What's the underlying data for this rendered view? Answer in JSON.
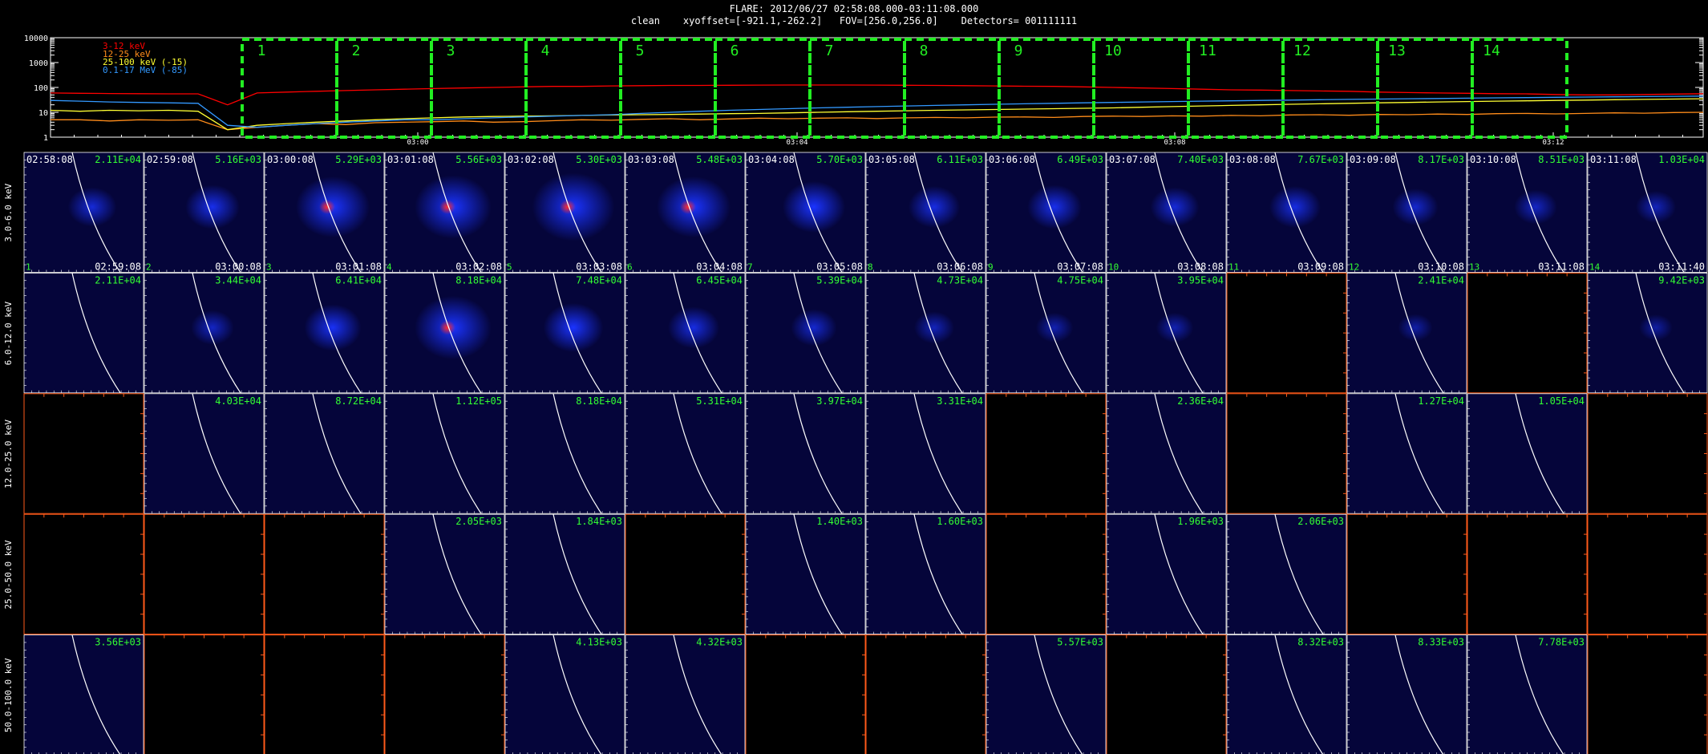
{
  "header": {
    "line1": "FLARE: 2012/06/27 02:58:08.000-03:11:08.000",
    "line2": "clean    xyoffset=[-921.1,-262.2]   FOV=[256.0,256.0]    Detectors= 001111111"
  },
  "chart_data": [
    {
      "type": "line",
      "name": "lightcurve",
      "yscale": "log",
      "ylim": [
        1,
        10000
      ],
      "y_ticks": [
        "10000",
        "1000",
        "100",
        "10",
        "1"
      ],
      "x_ticks": [
        "03:00",
        "03:04",
        "03:08",
        "03:12"
      ],
      "legend_position": "top-left",
      "series": [
        {
          "name": "3-12 keV",
          "color": "#ff0000",
          "values": [
            60,
            58,
            57,
            56,
            55,
            55,
            20,
            60,
            65,
            70,
            75,
            80,
            85,
            90,
            95,
            100,
            105,
            110,
            110,
            115,
            118,
            120,
            120,
            122,
            124,
            125,
            125,
            125,
            124,
            122,
            120,
            118,
            115,
            112,
            110,
            105,
            100,
            95,
            90,
            85,
            80,
            78,
            75,
            72,
            70,
            65,
            62,
            60,
            58,
            56,
            55,
            52,
            50,
            50,
            52,
            54,
            56
          ]
        },
        {
          "name": "12-25 keV",
          "color": "#ff8c1a",
          "values": [
            5,
            5,
            4.5,
            5,
            4.8,
            5,
            2,
            2.5,
            3,
            3.5,
            3.2,
            3.8,
            4,
            4.2,
            4.5,
            4,
            4.2,
            4.6,
            5,
            4.8,
            5.2,
            5.5,
            5,
            5.4,
            5.8,
            5.5,
            5.8,
            6,
            5.6,
            6,
            6.2,
            6,
            6.4,
            6.5,
            6.2,
            6.8,
            7,
            6.8,
            7.2,
            7,
            7.5,
            7.2,
            7.8,
            8,
            7.6,
            8.2,
            8,
            8.5,
            8.2,
            8.8,
            9,
            8.6,
            9,
            9.5,
            9.2,
            9.8,
            10
          ]
        },
        {
          "name": "25-100 keV (-15)",
          "color": "#ffff33",
          "values": [
            12,
            11,
            12,
            11.5,
            12,
            11,
            2,
            3,
            3.5,
            4,
            4.5,
            5,
            5.5,
            6,
            6.5,
            6.8,
            7,
            7.2,
            7.5,
            7.8,
            8,
            8.2,
            8.5,
            8.8,
            9,
            9.5,
            10,
            10.5,
            11,
            11.5,
            12,
            12.5,
            13,
            13.5,
            14,
            14.5,
            15,
            16,
            17,
            18,
            19,
            20,
            21,
            22,
            23,
            24,
            25,
            26,
            27,
            28,
            29,
            30,
            31,
            32,
            33,
            34,
            35
          ]
        },
        {
          "name": "0.1-17 MeV (-85)",
          "color": "#3399ff",
          "values": [
            30,
            28,
            26,
            25,
            24,
            23,
            3,
            2.5,
            3,
            3.5,
            4,
            4.5,
            5,
            5,
            5.5,
            6,
            6.5,
            7,
            7.5,
            8,
            9,
            10,
            11,
            12,
            13,
            14,
            15,
            16,
            17,
            18,
            19,
            20,
            21,
            22,
            23,
            24,
            25,
            26,
            27,
            28,
            29,
            30,
            31,
            32,
            33,
            34,
            35,
            36,
            37,
            38,
            39,
            40,
            41,
            42,
            43,
            44,
            45
          ]
        }
      ],
      "intervals": [
        "1",
        "2",
        "3",
        "4",
        "5",
        "6",
        "7",
        "8",
        "9",
        "10",
        "11",
        "12",
        "13",
        "14"
      ]
    },
    {
      "type": "heatmap",
      "name": "image-grid",
      "rows": [
        "3.0-6.0 keV",
        "6.0-12.0 keV",
        "12.0-25.0 keV",
        "25.0-50.0 keV",
        "50.0-100.0 keV"
      ],
      "start_times": [
        "02:58:08",
        "02:59:08",
        "03:00:08",
        "03:01:08",
        "03:02:08",
        "03:03:08",
        "03:04:08",
        "03:05:08",
        "03:06:08",
        "03:07:08",
        "03:08:08",
        "03:09:08",
        "03:10:08",
        "03:11:08"
      ],
      "end_times": [
        "02:59:08",
        "03:00:08",
        "03:01:08",
        "03:02:08",
        "03:03:08",
        "03:04:08",
        "03:05:08",
        "03:06:08",
        "03:07:08",
        "03:08:08",
        "03:09:08",
        "03:10:08",
        "03:11:08",
        "03:11:40"
      ],
      "interval_numbers": [
        "1",
        "2",
        "3",
        "4",
        "5",
        "6",
        "7",
        "8",
        "9",
        "10",
        "11",
        "12",
        "13",
        "14"
      ],
      "maxima": [
        [
          "2.11E+04",
          "5.16E+03",
          "5.29E+03",
          "5.56E+03",
          "5.30E+03",
          "5.48E+03",
          "5.70E+03",
          "6.11E+03",
          "6.49E+03",
          "7.40E+03",
          "7.67E+03",
          "8.17E+03",
          "8.51E+03",
          "1.03E+04"
        ],
        [
          "2.11E+04",
          "3.44E+04",
          "6.41E+04",
          "8.18E+04",
          "7.48E+04",
          "6.45E+04",
          "5.39E+04",
          "4.73E+04",
          "4.75E+04",
          "3.95E+04",
          null,
          "2.41E+04",
          null,
          "9.42E+03"
        ],
        [
          null,
          "4.03E+04",
          "8.72E+04",
          "1.12E+05",
          "8.18E+04",
          "5.31E+04",
          "3.97E+04",
          "3.31E+04",
          null,
          "2.36E+04",
          null,
          "1.27E+04",
          "1.05E+04",
          null
        ],
        [
          null,
          null,
          null,
          "2.05E+03",
          "1.84E+03",
          null,
          "1.40E+03",
          "1.60E+03",
          null,
          "1.96E+03",
          "2.06E+03",
          null,
          null,
          null
        ],
        [
          "3.56E+03",
          null,
          null,
          null,
          "4.13E+03",
          "4.32E+03",
          null,
          null,
          "5.57E+03",
          null,
          "8.32E+03",
          "8.33E+03",
          "7.78E+03",
          null
        ]
      ],
      "source_intensity": [
        [
          0.35,
          0.45,
          0.8,
          0.85,
          0.95,
          0.8,
          0.6,
          0.4,
          0.45,
          0.35,
          0.4,
          0.3,
          0.25,
          0.2
        ],
        [
          0,
          0.25,
          0.5,
          0.85,
          0.55,
          0.4,
          0.3,
          0.2,
          0.15,
          0.15,
          0,
          0.1,
          0,
          0.08
        ],
        [
          0,
          0,
          0,
          0,
          0,
          0,
          0,
          0,
          0,
          0,
          0,
          0,
          0,
          0
        ],
        [
          0,
          0,
          0,
          0,
          0,
          0,
          0,
          0,
          0,
          0,
          0,
          0,
          0,
          0
        ],
        [
          0,
          0,
          0,
          0,
          0,
          0,
          0,
          0,
          0,
          0,
          0,
          0,
          0,
          0
        ]
      ],
      "colors": {
        "panel": "#05053a",
        "source": "#1a33ff",
        "core": "#ff2a2a",
        "limb": "#ffffff",
        "empty_axis": "#ff5a1a",
        "label_start": "#ffffff",
        "label_max": "#33ff33"
      }
    }
  ]
}
